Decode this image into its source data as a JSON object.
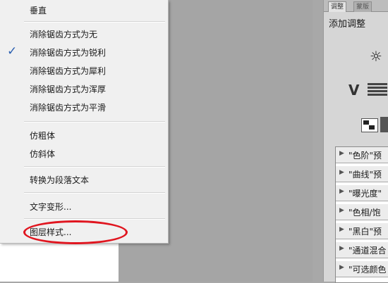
{
  "menu": {
    "items": [
      {
        "label": "垂直",
        "checked": false
      },
      {
        "label": "消除锯齿方式为无",
        "checked": false
      },
      {
        "label": "消除锯齿方式为锐利",
        "checked": true
      },
      {
        "label": "消除锯齿方式为犀利",
        "checked": false
      },
      {
        "label": "消除锯齿方式为浑厚",
        "checked": false
      },
      {
        "label": "消除锯齿方式为平滑",
        "checked": false
      },
      {
        "label": "仿粗体",
        "checked": false
      },
      {
        "label": "仿斜体",
        "checked": false
      },
      {
        "label": "转换为段落文本",
        "checked": false
      },
      {
        "label": "文字变形...",
        "checked": false
      },
      {
        "label": "图层样式...",
        "checked": false,
        "highlighted_by_annotation": true
      }
    ],
    "check_glyph": "✓"
  },
  "annotation": {
    "color": "#e0151f",
    "shape": "ellipse"
  },
  "panel": {
    "tabs": [
      "调整",
      "蒙版"
    ],
    "title": "添加调整",
    "icons": [
      "brightness-icon",
      "vibrance-icon",
      "levels-bars-icon",
      "selective-swatch-icon"
    ],
    "sun_glyph": "☼",
    "v_glyph": "V",
    "presets": [
      "\"色阶\"预",
      "\"曲线\"预",
      "\"曝光度\"",
      "\"色相/饱",
      "\"黑白\"预",
      "\"通道混合",
      "\"可选颜色"
    ],
    "preset_arrow": "▶"
  }
}
